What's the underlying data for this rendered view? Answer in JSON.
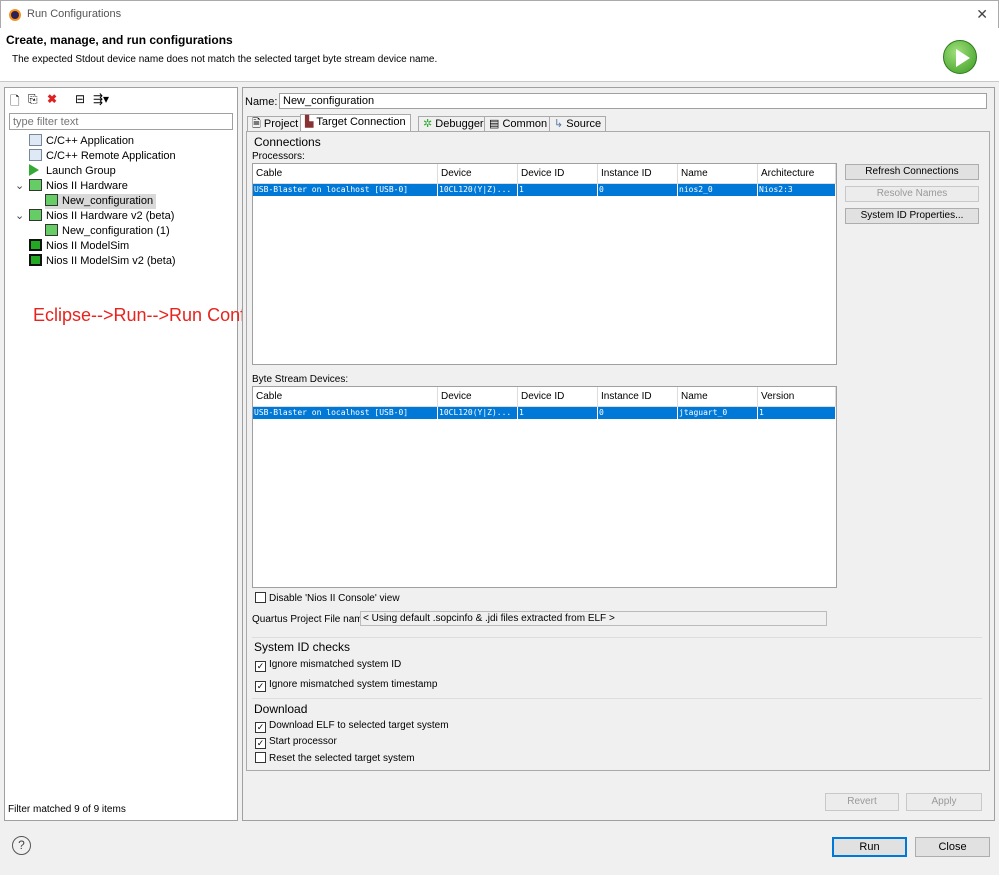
{
  "window": {
    "title": "Run Configurations",
    "close": "✕"
  },
  "header": {
    "title": "Create, manage, and run configurations",
    "message": "The expected Stdout device name does not match the selected target byte stream device name."
  },
  "left": {
    "filter_placeholder": "type filter text",
    "tree": [
      {
        "label": "C/C++ Application"
      },
      {
        "label": "C/C++ Remote Application"
      },
      {
        "label": "Launch Group"
      },
      {
        "label": "Nios II Hardware"
      },
      {
        "label": "New_configuration"
      },
      {
        "label": "Nios II Hardware v2 (beta)"
      },
      {
        "label": "New_configuration (1)"
      },
      {
        "label": "Nios II ModelSim"
      },
      {
        "label": "Nios II ModelSim v2 (beta)"
      }
    ],
    "status": "Filter matched 9 of 9 items"
  },
  "annotation": "Eclipse-->Run-->Run Configurations",
  "name_label": "Name:",
  "name_value": "New_configuration",
  "tabs": [
    "Project",
    "Target Connection",
    "Debugger",
    "Common",
    "Source"
  ],
  "connections": {
    "title": "Connections",
    "processors_label": "Processors:",
    "proc_headers": [
      "Cable",
      "Device",
      "Device ID",
      "Instance ID",
      "Name",
      "Architecture"
    ],
    "proc_row": [
      "USB-Blaster on localhost [USB-0]",
      "10CL120(Y|Z)...",
      "1",
      "0",
      "nios2_0",
      "Nios2:3"
    ],
    "bytestream_label": "Byte Stream Devices:",
    "bs_headers": [
      "Cable",
      "Device",
      "Device ID",
      "Instance ID",
      "Name",
      "Version"
    ],
    "bs_row": [
      "USB-Blaster on localhost [USB-0]",
      "10CL120(Y|Z)...",
      "1",
      "0",
      "jtaguart_0",
      "1"
    ],
    "refresh": "Refresh Connections",
    "resolve": "Resolve Names",
    "sysid": "System ID Properties...",
    "disable_console": "Disable 'Nios II Console' view",
    "quartus_label": "Quartus Project File name:",
    "quartus_value": "< Using default .sopcinfo & .jdi files extracted from ELF >"
  },
  "sysid": {
    "title": "System ID checks",
    "ignore_id": "Ignore mismatched system ID",
    "ignore_ts": "Ignore mismatched system timestamp"
  },
  "download": {
    "title": "Download",
    "elf": "Download ELF to selected target system",
    "start": "Start processor",
    "reset": "Reset the selected target system"
  },
  "buttons": {
    "revert": "Revert",
    "apply": "Apply",
    "run": "Run",
    "close": "Close",
    "help": "?"
  }
}
